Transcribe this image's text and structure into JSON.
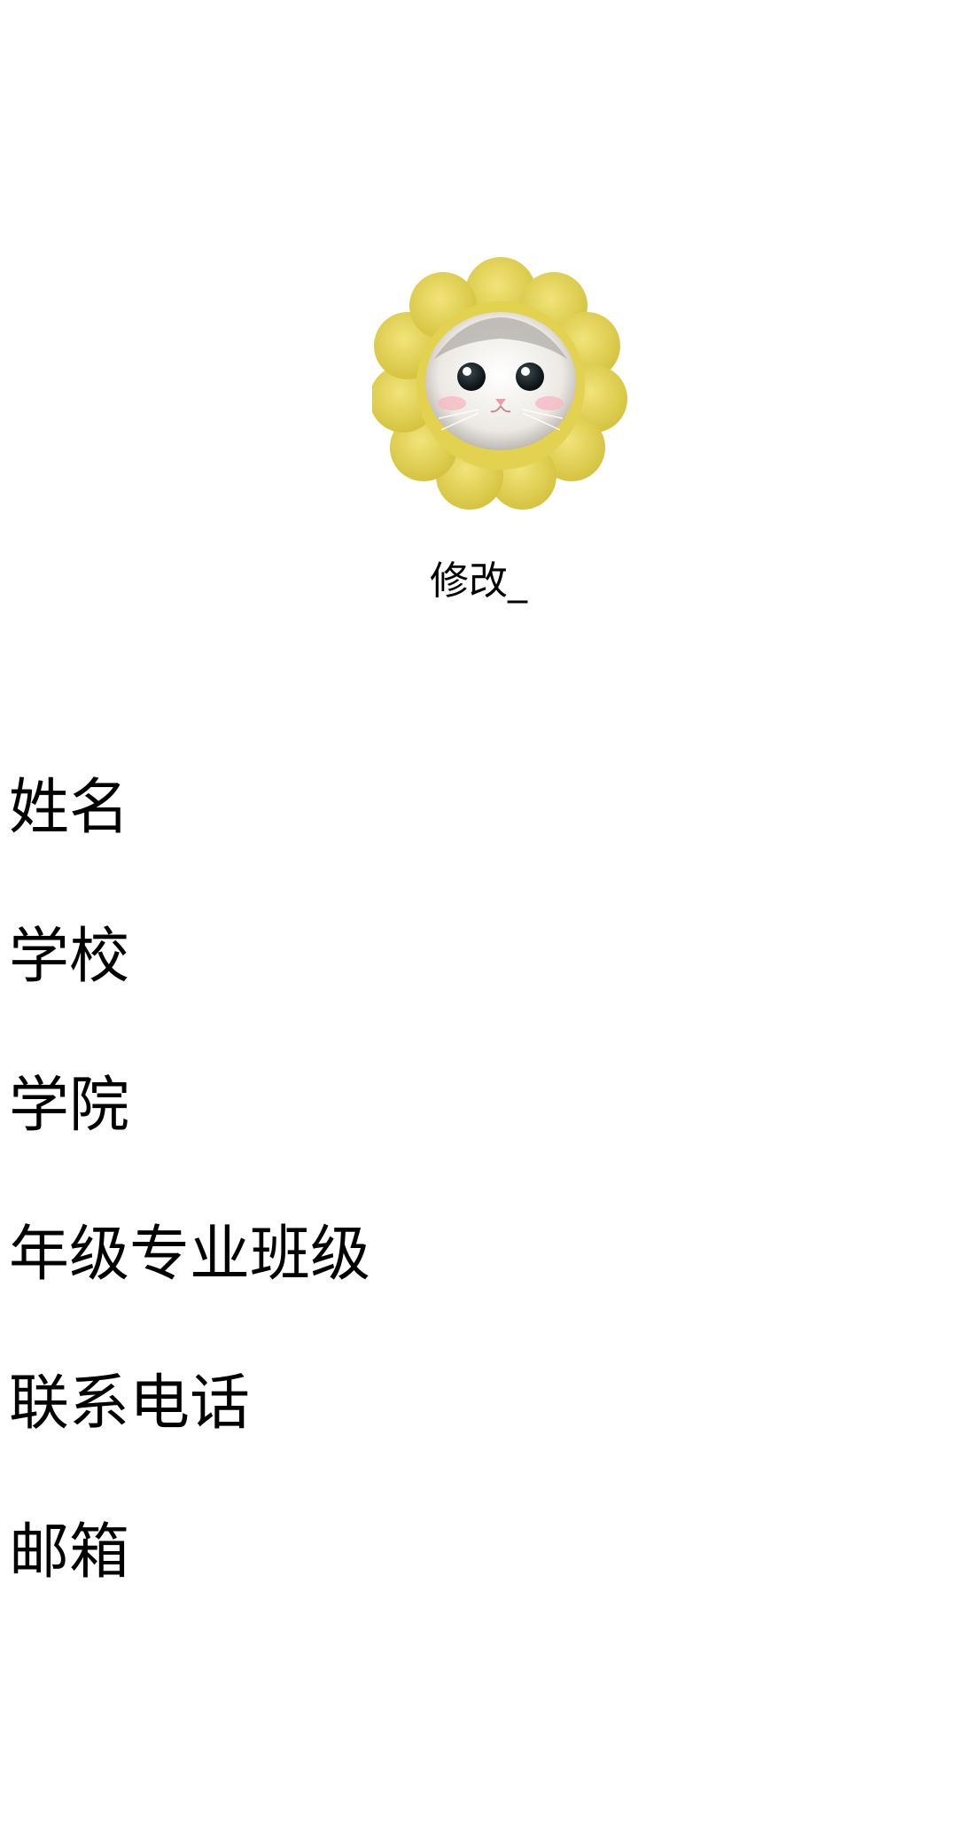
{
  "avatar": {
    "description_icon": "cat-in-sunflower-hat-avatar"
  },
  "edit_label": "修改_",
  "fields": [
    {
      "label": "姓名"
    },
    {
      "label": "学校"
    },
    {
      "label": "学院"
    },
    {
      "label": "年级专业班级"
    },
    {
      "label": "联系电话"
    },
    {
      "label": "邮箱"
    }
  ],
  "colors": {
    "background": "#ffffff",
    "text": "#000000",
    "petal": "#e8d85a",
    "petal_shade": "#d9c746",
    "cat_face": "#f2efea"
  }
}
